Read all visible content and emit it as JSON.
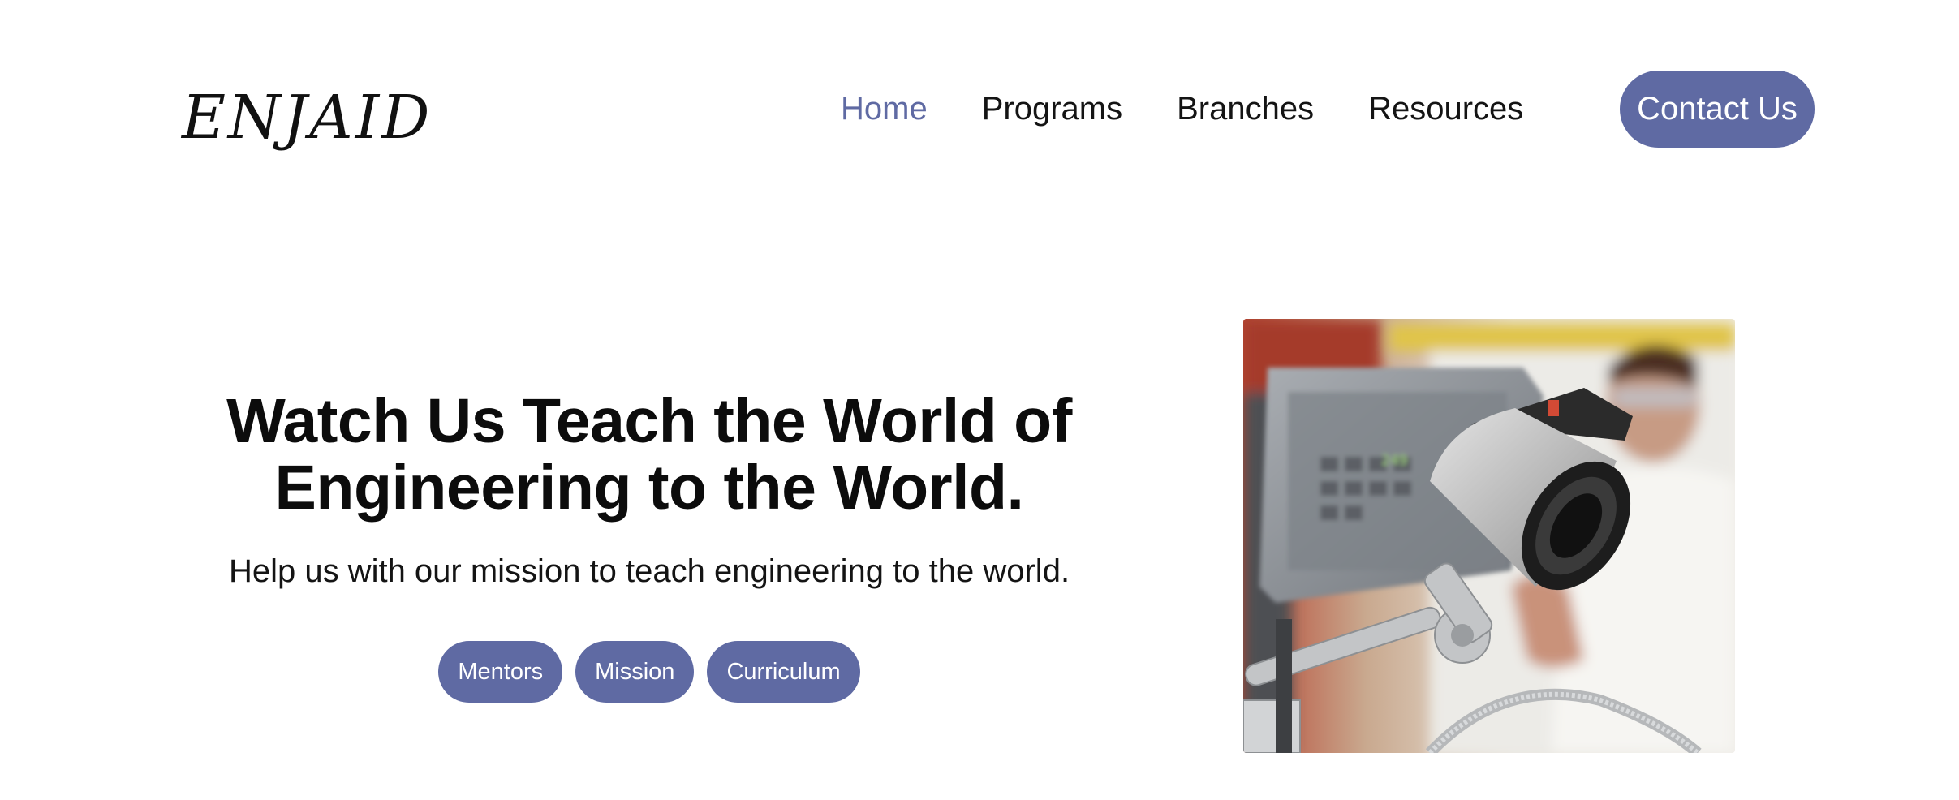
{
  "header": {
    "logo_text": "ENJAID",
    "nav": [
      {
        "label": "Home",
        "active": true
      },
      {
        "label": "Programs",
        "active": false
      },
      {
        "label": "Branches",
        "active": false
      },
      {
        "label": "Resources",
        "active": false
      }
    ],
    "contact_label": "Contact Us"
  },
  "hero": {
    "title_line1": "Watch Us Teach the World of",
    "title_line2": "Engineering to the World.",
    "subtitle": "Help us with our mission to teach engineering to the world.",
    "buttons": [
      {
        "label": "Mentors"
      },
      {
        "label": "Mission"
      },
      {
        "label": "Curriculum"
      }
    ],
    "image": {
      "subject": "engineer-with-industrial-camera-machine"
    }
  },
  "colors": {
    "accent": "#5f6aa3",
    "text": "#111111",
    "background": "#ffffff"
  }
}
